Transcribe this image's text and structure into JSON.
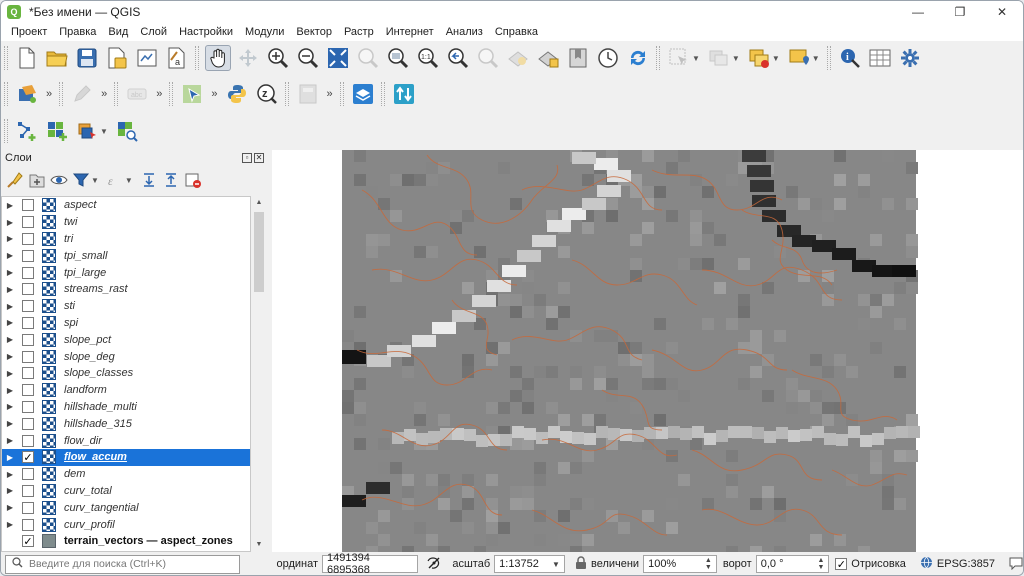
{
  "window": {
    "title": "*Без имени — QGIS",
    "app_icon": "Q",
    "minimize": "—",
    "maximize": "❐",
    "close": "✕"
  },
  "menu": [
    "Проект",
    "Правка",
    "Вид",
    "Слой",
    "Настройки",
    "Модули",
    "Вектор",
    "Растр",
    "Интернет",
    "Анализ",
    "Справка"
  ],
  "toolbar": {
    "overflow": "»"
  },
  "layers_panel": {
    "title": "Слои",
    "float_btn": "▫",
    "close_btn": "✕",
    "layers": [
      {
        "name": "aspect",
        "checked": false,
        "selected": false,
        "type": "raster"
      },
      {
        "name": "twi",
        "checked": false,
        "selected": false,
        "type": "raster"
      },
      {
        "name": "tri",
        "checked": false,
        "selected": false,
        "type": "raster"
      },
      {
        "name": "tpi_small",
        "checked": false,
        "selected": false,
        "type": "raster"
      },
      {
        "name": "tpi_large",
        "checked": false,
        "selected": false,
        "type": "raster"
      },
      {
        "name": "streams_rast",
        "checked": false,
        "selected": false,
        "type": "raster"
      },
      {
        "name": "sti",
        "checked": false,
        "selected": false,
        "type": "raster"
      },
      {
        "name": "spi",
        "checked": false,
        "selected": false,
        "type": "raster"
      },
      {
        "name": "slope_pct",
        "checked": false,
        "selected": false,
        "type": "raster"
      },
      {
        "name": "slope_deg",
        "checked": false,
        "selected": false,
        "type": "raster"
      },
      {
        "name": "slope_classes",
        "checked": false,
        "selected": false,
        "type": "raster"
      },
      {
        "name": "landform",
        "checked": false,
        "selected": false,
        "type": "raster"
      },
      {
        "name": "hillshade_multi",
        "checked": false,
        "selected": false,
        "type": "raster"
      },
      {
        "name": "hillshade_315",
        "checked": false,
        "selected": false,
        "type": "raster"
      },
      {
        "name": "flow_dir",
        "checked": false,
        "selected": false,
        "type": "raster"
      },
      {
        "name": "flow_accum",
        "checked": true,
        "selected": true,
        "type": "raster"
      },
      {
        "name": "dem",
        "checked": false,
        "selected": false,
        "type": "raster"
      },
      {
        "name": "curv_total",
        "checked": false,
        "selected": false,
        "type": "raster"
      },
      {
        "name": "curv_tangential",
        "checked": false,
        "selected": false,
        "type": "raster"
      },
      {
        "name": "curv_profil",
        "checked": false,
        "selected": false,
        "type": "raster"
      },
      {
        "name": "terrain_vectors — aspect_zones",
        "checked": true,
        "selected": false,
        "type": "vector"
      }
    ]
  },
  "statusbar": {
    "search_placeholder": "Введите для поиска (Ctrl+K)",
    "coord_label": "ординат",
    "coord_value": "1491394  6895368",
    "scale_label": "асштаб",
    "scale_value": "1:13752",
    "magnifier_label": "величени",
    "magnifier_value": "100%",
    "rotation_label": "ворот",
    "rotation_value": "0,0 °",
    "render_label": "Отрисовка",
    "render_checked": true,
    "crs": "EPSG:3857"
  },
  "colors": {
    "selection": "#1a73d9",
    "contour": "#c8693a",
    "raster_bg": "#878787"
  }
}
